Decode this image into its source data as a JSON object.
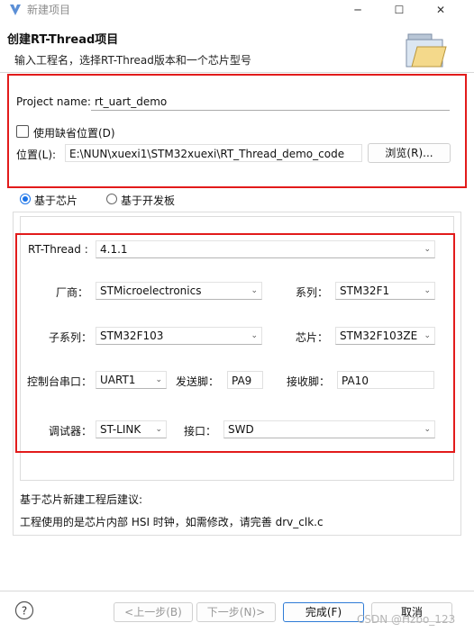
{
  "window": {
    "title": "新建项目",
    "controls": {
      "minimize": "─",
      "maximize": "☐",
      "close": "✕"
    }
  },
  "header": {
    "title": "创建RT-Thread项目",
    "description": "输入工程名，选择RT-Thread版本和一个芯片型号"
  },
  "project": {
    "name_label": "Project name:",
    "name_value": "rt_uart_demo",
    "default_location_label": "使用缺省位置(D)",
    "location_label": "位置(L):",
    "location_value": "E:\\NUN\\xuexi1\\STM32xuexi\\RT_Thread_demo_code",
    "browse_label": "浏览(R)..."
  },
  "base": {
    "option_chip": "基于芯片",
    "option_board": "基于开发板",
    "selected": "option_chip"
  },
  "chip_settings": {
    "rtthread_label": "RT-Thread :",
    "rtthread_value": "4.1.1",
    "vendor_label": "厂商：",
    "vendor_value": "STMicroelectronics",
    "series_label": "系列：",
    "series_value": "STM32F1",
    "subseries_label": "子系列：",
    "subseries_value": "STM32F103",
    "chip_label": "芯片：",
    "chip_value": "STM32F103ZE",
    "console_label": "控制台串口：",
    "console_value": "UART1",
    "tx_label": "发送脚：",
    "tx_value": "PA9",
    "rx_label": "接收脚：",
    "rx_value": "PA10",
    "debugger_label": "调试器：",
    "debugger_value": "ST-LINK",
    "interface_label": "接口：",
    "interface_value": "SWD"
  },
  "suggestion": {
    "title": "基于芯片新建工程后建议:",
    "text": "工程使用的是芯片内部 HSI 时钟，如需修改，请完善 drv_clk.c"
  },
  "buttons": {
    "back": "<上一步(B)",
    "next": "下一步(N)>",
    "finish": "完成(F)",
    "cancel": "取消"
  },
  "watermark": "CSDN @Hzbo_123",
  "colors": {
    "highlight_border": "#e21b1b",
    "accent": "#1a73e8"
  }
}
